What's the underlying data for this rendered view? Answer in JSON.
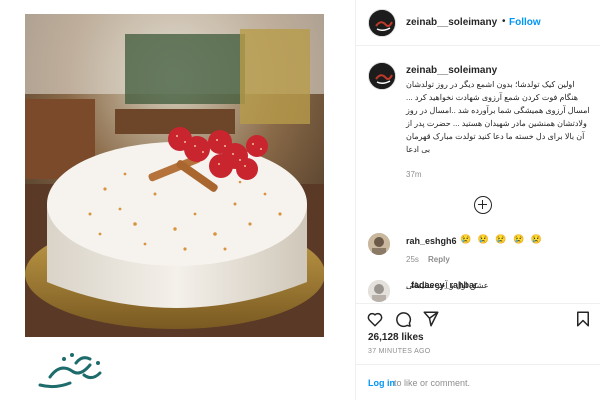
{
  "post": {
    "username": "zeinab__soleimany",
    "follow_label": "Follow",
    "separator": "•",
    "more_icon": "more-icon"
  },
  "caption": {
    "username": "zeinab__soleimany",
    "text": "اولین کیک تولدشا؛ بدون اشمع دیگر در روز تولدشان هنگام فوت کردن شمع آرزوی شهادت نخواهید کرد ... امسال آرزوی همیشگی شما برآورده شد ..امسال در روز ولادتشان همنشین مادر شهیدان هستید ... حضرت پدر از آن بالا برای دل خسته ما دعا کنید تولدت مبارک قهرمان بی ادعا",
    "time": "37m"
  },
  "load_more_icon": "plus-circle-icon",
  "comments": [
    {
      "username": "rah_eshgh6",
      "text": "😢 😢 😢 😢 😢",
      "time": "25s",
      "reply_label": "Reply"
    },
    {
      "username": "_fadaeey_rahbar",
      "text": "عشق اول و آخر سلیمانی"
    }
  ],
  "actions": [
    "heart-icon",
    "comment-icon",
    "share-icon",
    "bookmark-icon"
  ],
  "likes": "26,128 likes",
  "timestamp": "37 MINUTES AGO",
  "login": {
    "link": "Log in",
    "rest": "to like or comment."
  },
  "watermark": "یعنی کار خیر",
  "colors": {
    "link_blue": "#0095f6",
    "muted_gray": "#8e8e8e",
    "text": "#262626",
    "border": "#efefef"
  }
}
